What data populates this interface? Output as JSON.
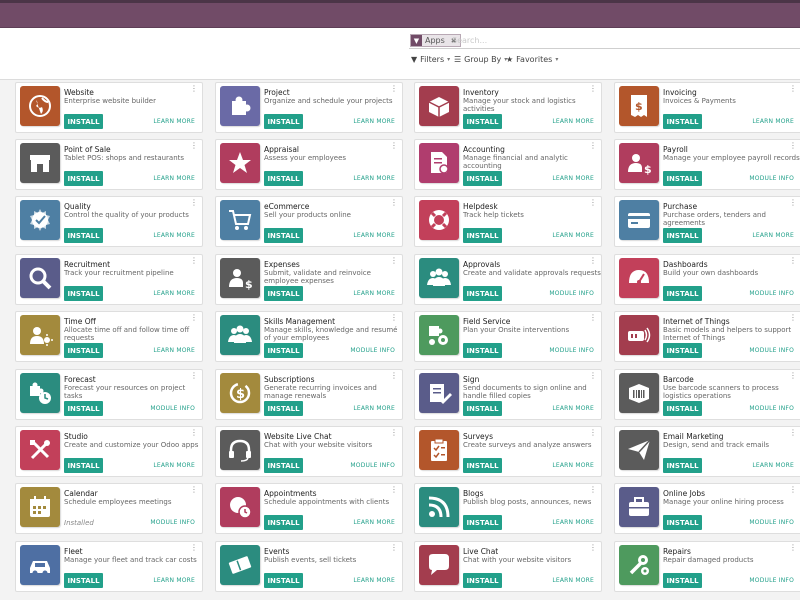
{
  "search": {
    "facet_label": "Apps",
    "placeholder": "Search..."
  },
  "controls": {
    "filters": "Filters",
    "group_by": "Group By",
    "favorites": "Favorites"
  },
  "columns": [
    [
      {
        "name": "Website",
        "desc": "Enterprise website builder",
        "action": "INSTALL",
        "link": "LEARN MORE",
        "color": "#b3562b",
        "icon": "globe"
      },
      {
        "name": "Point of Sale",
        "desc": "Tablet POS: shops and restaurants",
        "action": "INSTALL",
        "link": "LEARN MORE",
        "color": "#5b5b5b",
        "icon": "shop"
      },
      {
        "name": "Quality",
        "desc": "Control the quality of your products",
        "action": "INSTALL",
        "link": "LEARN MORE",
        "color": "#4e7fa3",
        "icon": "seal"
      },
      {
        "name": "Recruitment",
        "desc": "Track your recruitment pipeline",
        "action": "INSTALL",
        "link": "LEARN MORE",
        "color": "#5a5c8a",
        "icon": "magnifier"
      },
      {
        "name": "Time Off",
        "desc": "Allocate time off and follow time off requests",
        "action": "INSTALL",
        "link": "LEARN MORE",
        "color": "#a38a3d",
        "icon": "person-sun"
      },
      {
        "name": "Forecast",
        "desc": "Forecast your resources on project tasks",
        "action": "INSTALL",
        "link": "MODULE INFO",
        "color": "#2b8c7f",
        "icon": "puzzle-clock"
      },
      {
        "name": "Studio",
        "desc": "Create and customize your Odoo apps",
        "action": "INSTALL",
        "link": "LEARN MORE",
        "color": "#c2405a",
        "icon": "tools"
      },
      {
        "name": "Calendar",
        "desc": "Schedule employees meetings",
        "action": "Installed",
        "link": "MODULE INFO",
        "color": "#a38a3d",
        "icon": "calendar"
      },
      {
        "name": "Fleet",
        "desc": "Manage your fleet and track car costs",
        "action": "INSTALL",
        "link": "LEARN MORE",
        "color": "#4e6fa3",
        "icon": "car"
      }
    ],
    [
      {
        "name": "Project",
        "desc": "Organize and schedule your projects",
        "action": "INSTALL",
        "link": "LEARN MORE",
        "color": "#6a6aa6",
        "icon": "puzzle"
      },
      {
        "name": "Appraisal",
        "desc": "Assess your employees",
        "action": "INSTALL",
        "link": "LEARN MORE",
        "color": "#b03d5e",
        "icon": "star"
      },
      {
        "name": "eCommerce",
        "desc": "Sell your products online",
        "action": "INSTALL",
        "link": "LEARN MORE",
        "color": "#4e7fa3",
        "icon": "cart"
      },
      {
        "name": "Expenses",
        "desc": "Submit, validate and reinvoice employee expenses",
        "action": "INSTALL",
        "link": "LEARN MORE",
        "color": "#5b5b5b",
        "icon": "person-dollar"
      },
      {
        "name": "Skills Management",
        "desc": "Manage skills, knowledge and resumé of your employees",
        "action": "INSTALL",
        "link": "MODULE INFO",
        "color": "#2b8c7f",
        "icon": "people"
      },
      {
        "name": "Subscriptions",
        "desc": "Generate recurring invoices and manage renewals",
        "action": "INSTALL",
        "link": "LEARN MORE",
        "color": "#a38a3d",
        "icon": "dollar-cycle"
      },
      {
        "name": "Website Live Chat",
        "desc": "Chat with your website visitors",
        "action": "INSTALL",
        "link": "MODULE INFO",
        "color": "#5b5b5b",
        "icon": "headset"
      },
      {
        "name": "Appointments",
        "desc": "Schedule appointments with clients",
        "action": "INSTALL",
        "link": "LEARN MORE",
        "color": "#b03d5e",
        "icon": "globe-clock"
      },
      {
        "name": "Events",
        "desc": "Publish events, sell tickets",
        "action": "INSTALL",
        "link": "LEARN MORE",
        "color": "#2b8c7f",
        "icon": "ticket"
      }
    ],
    [
      {
        "name": "Inventory",
        "desc": "Manage your stock and logistics activities",
        "action": "INSTALL",
        "link": "LEARN MORE",
        "color": "#a33d4e",
        "icon": "box"
      },
      {
        "name": "Accounting",
        "desc": "Manage financial and analytic accounting",
        "action": "INSTALL",
        "link": "LEARN MORE",
        "color": "#b03d6e",
        "icon": "document-gear"
      },
      {
        "name": "Helpdesk",
        "desc": "Track help tickets",
        "action": "INSTALL",
        "link": "LEARN MORE",
        "color": "#c2405a",
        "icon": "lifebuoy"
      },
      {
        "name": "Approvals",
        "desc": "Create and validate approvals requests",
        "action": "INSTALL",
        "link": "MODULE INFO",
        "color": "#2b8c7f",
        "icon": "people"
      },
      {
        "name": "Field Service",
        "desc": "Plan your Onsite interventions",
        "action": "INSTALL",
        "link": "MODULE INFO",
        "color": "#4e9a5e",
        "icon": "puzzle-gear"
      },
      {
        "name": "Sign",
        "desc": "Send documents to sign online and handle filled copies",
        "action": "INSTALL",
        "link": "LEARN MORE",
        "color": "#5a5c8a",
        "icon": "pen"
      },
      {
        "name": "Surveys",
        "desc": "Create surveys and analyze answers",
        "action": "INSTALL",
        "link": "LEARN MORE",
        "color": "#b3562b",
        "icon": "clipboard"
      },
      {
        "name": "Blogs",
        "desc": "Publish blog posts, announces, news",
        "action": "INSTALL",
        "link": "LEARN MORE",
        "color": "#2b8c7f",
        "icon": "rss"
      },
      {
        "name": "Live Chat",
        "desc": "Chat with your website visitors",
        "action": "INSTALL",
        "link": "LEARN MORE",
        "color": "#a33d4e",
        "icon": "chat"
      }
    ],
    [
      {
        "name": "Invoicing",
        "desc": "Invoices & Payments",
        "action": "INSTALL",
        "link": "LEARN MORE",
        "color": "#b3562b",
        "icon": "invoice"
      },
      {
        "name": "Payroll",
        "desc": "Manage your employee payroll records",
        "action": "INSTALL",
        "link": "MODULE INFO",
        "color": "#b03d5e",
        "icon": "person-dollar"
      },
      {
        "name": "Purchase",
        "desc": "Purchase orders, tenders and agreements",
        "action": "INSTALL",
        "link": "LEARN MORE",
        "color": "#4e7fa3",
        "icon": "card"
      },
      {
        "name": "Dashboards",
        "desc": "Build your own dashboards",
        "action": "INSTALL",
        "link": "MODULE INFO",
        "color": "#c2405a",
        "icon": "gauge"
      },
      {
        "name": "Internet of Things",
        "desc": "Basic models and helpers to support Internet of Things",
        "action": "INSTALL",
        "link": "MODULE INFO",
        "color": "#a33d4e",
        "icon": "iot"
      },
      {
        "name": "Barcode",
        "desc": "Use barcode scanners to process logistics operations",
        "action": "INSTALL",
        "link": "MODULE INFO",
        "color": "#5b5b5b",
        "icon": "barcode"
      },
      {
        "name": "Email Marketing",
        "desc": "Design, send and track emails",
        "action": "INSTALL",
        "link": "LEARN MORE",
        "color": "#5b5b5b",
        "icon": "plane"
      },
      {
        "name": "Online Jobs",
        "desc": "Manage your online hiring process",
        "action": "INSTALL",
        "link": "MODULE INFO",
        "color": "#5a5c8a",
        "icon": "briefcase"
      },
      {
        "name": "Repairs",
        "desc": "Repair damaged products",
        "action": "INSTALL",
        "link": "MODULE INFO",
        "color": "#4e9a5e",
        "icon": "wrench-gear"
      }
    ]
  ]
}
